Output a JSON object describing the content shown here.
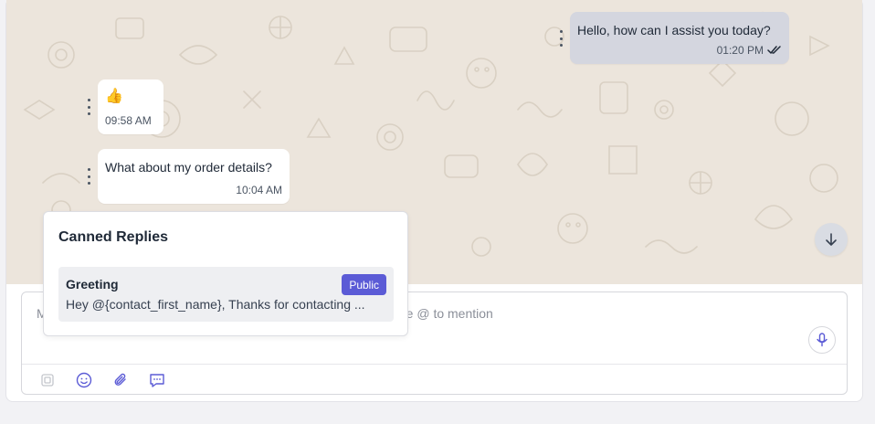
{
  "messages": [
    {
      "direction": "outgoing",
      "text": "Hello, how can I assist you today?",
      "time": "01:20 PM",
      "status": "read"
    },
    {
      "direction": "incoming",
      "text": "👍",
      "time": "09:58 AM"
    },
    {
      "direction": "incoming",
      "text": "What about my order details?",
      "time": "10:04 AM"
    }
  ],
  "composer": {
    "placeholder_start": "M",
    "placeholder_end": "e @ to mention",
    "toolbar": [
      {
        "name": "copy-icon"
      },
      {
        "name": "emoji-icon"
      },
      {
        "name": "paperclip-icon"
      },
      {
        "name": "canned-response-icon"
      }
    ],
    "mic_icon": "microphone-icon"
  },
  "canned_replies": {
    "title": "Canned Replies",
    "items": [
      {
        "name": "Greeting",
        "badge": "Public",
        "snippet": "Hey @{contact_first_name}, Thanks for contacting ..."
      }
    ]
  },
  "scroll_button_icon": "arrow-down-icon",
  "colors": {
    "chat_background": "#ece5dc",
    "outgoing_bubble": "#d4d6df",
    "incoming_bubble": "#ffffff",
    "accent": "#5b5bd6"
  }
}
